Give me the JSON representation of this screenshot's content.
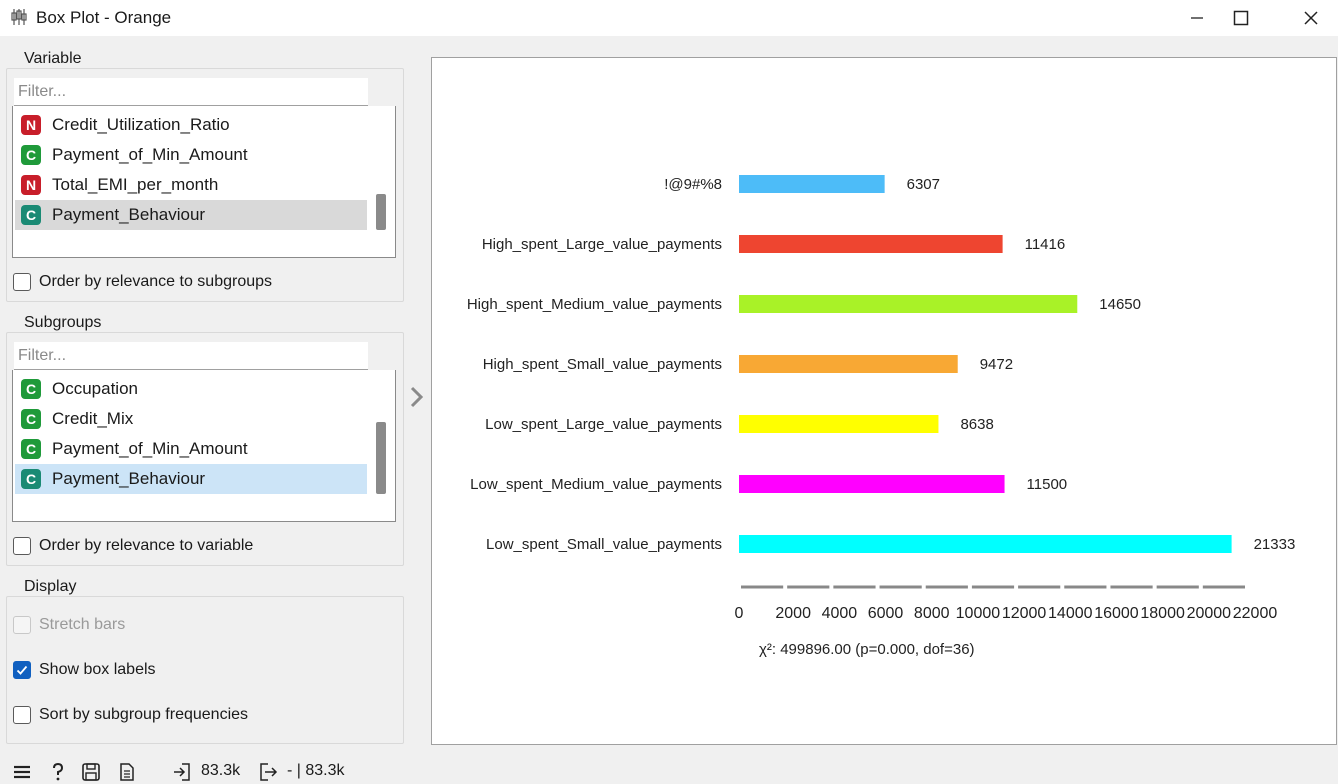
{
  "window": {
    "title": "Box Plot - Orange",
    "minimize_icon": "minimize-icon",
    "maximize_icon": "maximize-icon",
    "close_icon": "close-icon"
  },
  "variable": {
    "title": "Variable",
    "filter_placeholder": "Filter...",
    "items": [
      {
        "type": "N",
        "label": "Credit_Utilization_Ratio"
      },
      {
        "type": "C",
        "label": "Payment_of_Min_Amount"
      },
      {
        "type": "N",
        "label": "Total_EMI_per_month"
      },
      {
        "type": "C",
        "label": "Payment_Behaviour",
        "selected": true
      }
    ],
    "order_label": "Order by relevance to subgroups"
  },
  "subgroups": {
    "title": "Subgroups",
    "filter_placeholder": "Filter...",
    "items": [
      {
        "type": "C",
        "label": "Occupation"
      },
      {
        "type": "C",
        "label": "Credit_Mix"
      },
      {
        "type": "C",
        "label": "Payment_of_Min_Amount"
      },
      {
        "type": "C",
        "label": "Payment_Behaviour",
        "selected": true
      }
    ],
    "order_label": "Order by relevance to variable"
  },
  "display": {
    "title": "Display",
    "stretch_bars": {
      "label": "Stretch bars",
      "checked": false,
      "disabled": true
    },
    "show_box_labels": {
      "label": "Show box labels",
      "checked": true
    },
    "sort_by_freq": {
      "label": "Sort by subgroup frequencies",
      "checked": false
    }
  },
  "statusbar": {
    "input_count": "83.3k",
    "output_count": "- | 83.3k",
    "icons": [
      "menu-icon",
      "help-icon",
      "save-icon",
      "report-icon",
      "input-icon",
      "output-icon"
    ]
  },
  "chart_data": {
    "type": "bar",
    "orientation": "horizontal",
    "categories": [
      "!@9#%8",
      "High_spent_Large_value_payments",
      "High_spent_Medium_value_payments",
      "High_spent_Small_value_payments",
      "Low_spent_Large_value_payments",
      "Low_spent_Medium_value_payments",
      "Low_spent_Small_value_payments"
    ],
    "values": [
      6307,
      11416,
      14650,
      9472,
      8638,
      11500,
      21333
    ],
    "colors": [
      "#4dbcf8",
      "#ee4530",
      "#a9f227",
      "#f8a834",
      "#ffff00",
      "#ff00ff",
      "#00ffff"
    ],
    "xlim": [
      0,
      22000
    ],
    "xticks": [
      "0",
      "2000",
      "4000",
      "6000",
      "8000",
      "10000",
      "12000",
      "14000",
      "16000",
      "18000",
      "20000",
      "22000"
    ],
    "footer": "χ²: 499896.00 (p=0.000, dof=36)",
    "grid": false
  }
}
